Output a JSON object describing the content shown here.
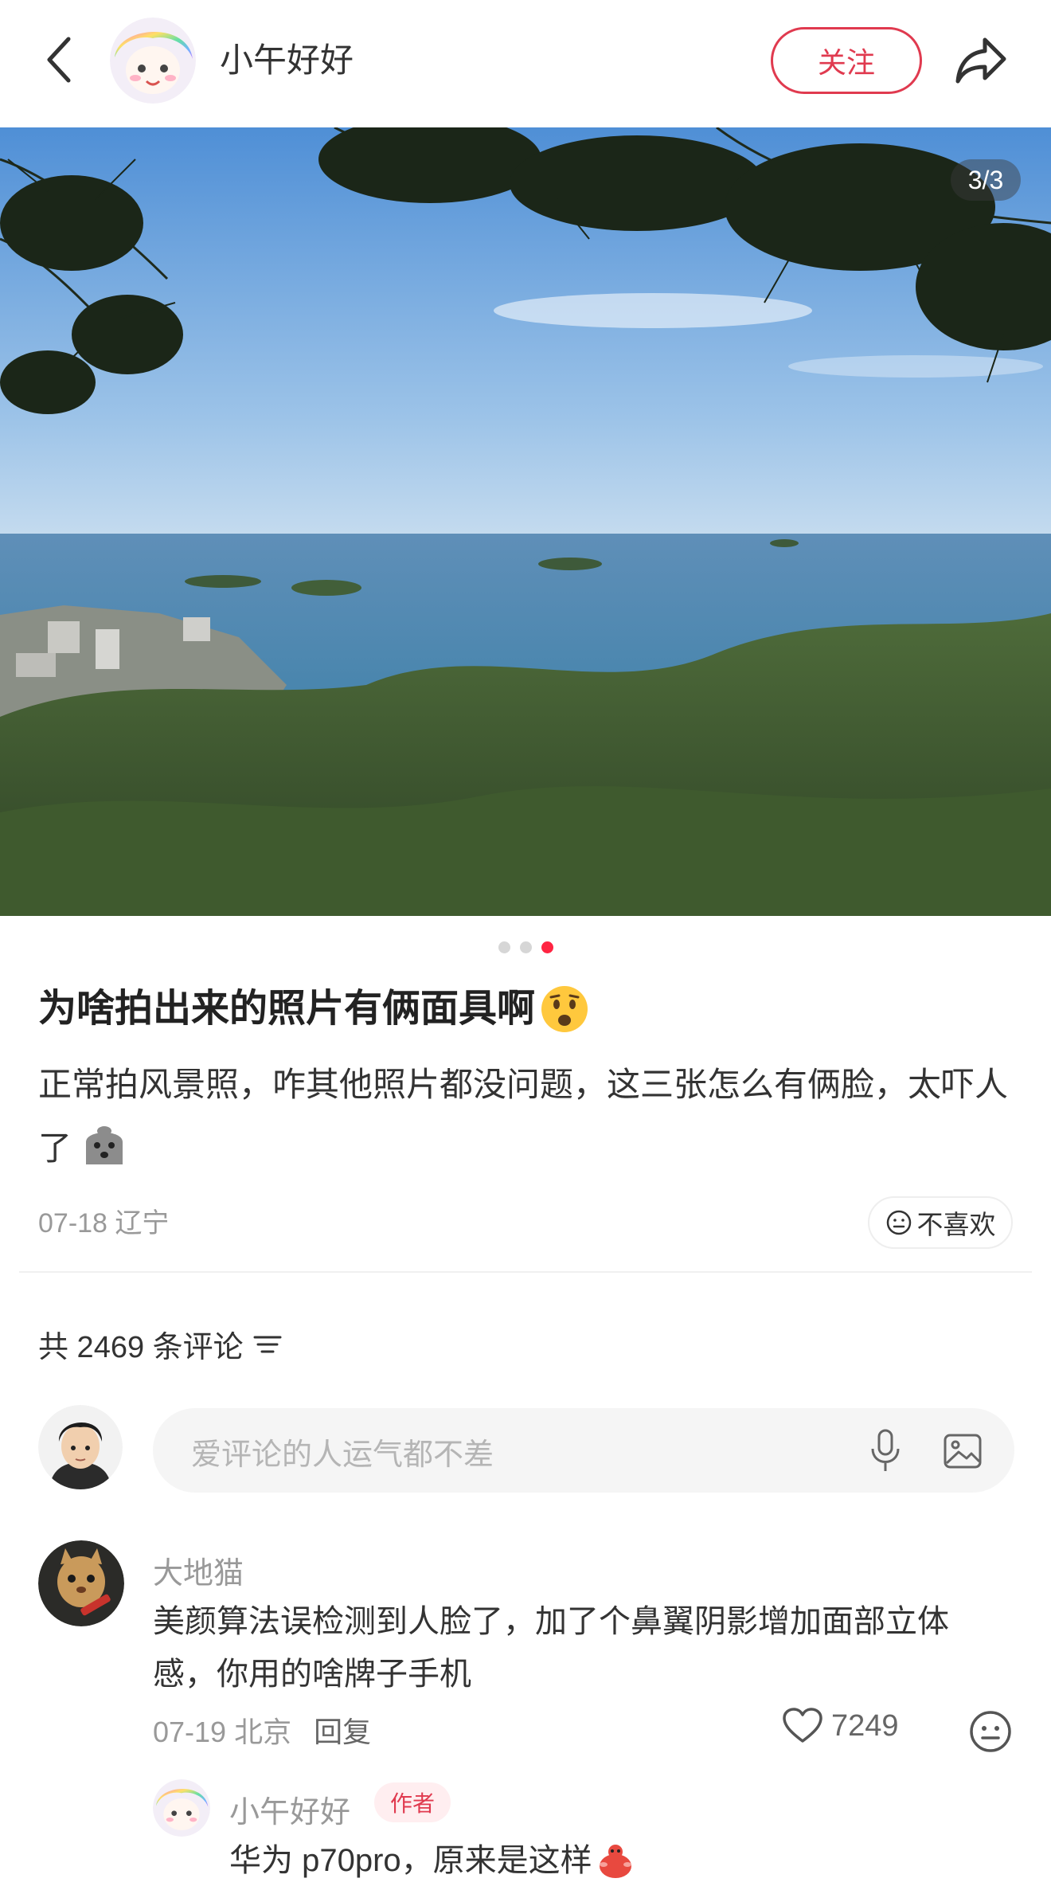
{
  "header": {
    "author_name": "小午好好",
    "follow_label": "关注",
    "back_icon": "chevron-left-icon",
    "share_icon": "share-arrow-icon"
  },
  "photo": {
    "counter": "3/3",
    "current_index": 3,
    "total": 3
  },
  "post": {
    "title": "为啥拍出来的照片有俩面具啊",
    "title_emoji": "frowning-face-emoji",
    "body": "正常拍风景照，咋其他照片都没问题，这三张怎么有俩脸，太吓人了",
    "body_emoji": "ghost-face-emoji",
    "date": "07-18",
    "location": "辽宁",
    "dislike_label": "不喜欢"
  },
  "comments": {
    "count_label": "共 2469 条评论",
    "input_placeholder": "爱评论的人运气都不差",
    "items": [
      {
        "user": "大地猫",
        "text": "美颜算法误检测到人脸了，加了个鼻翼阴影增加面部立体感，你用的啥牌子手机",
        "date": "07-19",
        "location": "北京",
        "reply_label": "回复",
        "likes": "7249",
        "replies": [
          {
            "user": "小午好好",
            "tag": "作者",
            "text": "华为 p70pro，原来是这样",
            "emoji": "red-creature-emoji"
          }
        ]
      }
    ]
  },
  "colors": {
    "accent": "#ff2442",
    "follow": "#e03a4f",
    "muted": "#999999"
  }
}
